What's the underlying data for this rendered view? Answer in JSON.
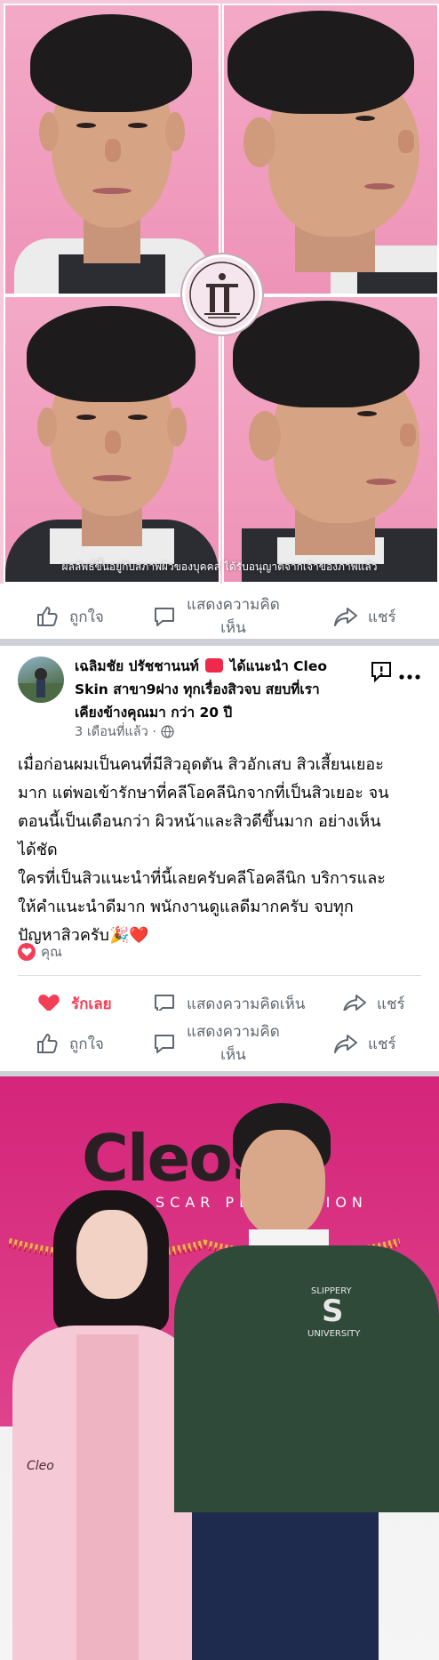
{
  "collage": {
    "disclaimer": "ผลลัพธ์ขึ้นอยู่กับสภาพผิวของบุคคล ได้รับอนุญาตจากเจ้าของภาพแล้ว",
    "logo_icon": "cleo-skin-logo-icon"
  },
  "actionbar_top": {
    "like": "ถูกใจ",
    "comment_line1": "แสดงความคิด",
    "comment_line2": "เห็น",
    "share": "แชร์"
  },
  "post": {
    "author": "เฉลิมชัย ปรัชชานนท์",
    "recommends": "ได้แนะนำ Cleo Skin สาขา9ฝาง ทุกเรื่องสิวจบ สยบที่เราเคียงข้างคุณมา กว่า 20 ปี",
    "recommends_line1": "ได้แนะนำ Cleo",
    "recommends_line2": "Skin สาขา9ฝาง ทุกเรื่องสิวจบ สยบที่เรา",
    "recommends_line3": "เคียงข้างคุณมา กว่า 20 ปี",
    "timestamp": "3 เดือนที่แล้ว ·",
    "body_p1_l1": "เมื่อก่อนผมเป็นคนที่มีสิวอุดตัน สิวอักเสบ สิวเสี้ยนเยอะ",
    "body_p1_l2": "มาก แต่พอเข้ารักษาที่คลีโอคลีนิกจากที่เป็นสิวเยอะ จน",
    "body_p1_l3": "ตอนนี้เป็นเดือนกว่า ผิวหน้าและสิวดีขึ้นมาก อย่างเห็น",
    "body_p1_l4": "ได้ชัด",
    "body_p2_l1": "ใครที่เป็นสิวแนะนำที่นี้เลยครับคลีโอคลีนิก บริการและ",
    "body_p2_l2": "ให้คำแนะนำดีมาก พนักงานดูแลดีมากครับ จบทุก",
    "body_p2_l3": "ปัญหาสิวครับ🎉❤️",
    "reaction_label": "คุณ",
    "love_label": "รักเลย",
    "comment_label": "แสดงความคิดเห็น",
    "share_label": "แชร์"
  },
  "actionbar_bottom": {
    "like": "ถูกใจ",
    "comment_line1": "แสดงความคิด",
    "comment_line2": "เห็น",
    "share": "แชร์"
  },
  "promo": {
    "brand": "CleoS",
    "sub": "ACNE SCAR PERFECTION",
    "shirt_text_1": "SLIPPERY",
    "shirt_letter": "S",
    "shirt_text_2": "UNIVERSITY",
    "coat_text": "Cleo"
  },
  "colors": {
    "accent_red": "#f02849",
    "love_red": "#f33e58",
    "muted_text": "#65676b",
    "brand_pink": "#d4257a"
  }
}
